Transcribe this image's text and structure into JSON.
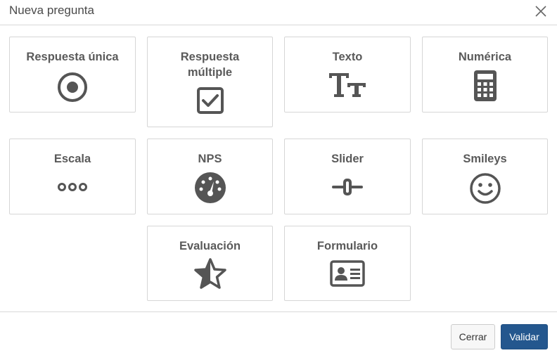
{
  "dialog": {
    "title": "Nueva pregunta"
  },
  "question_types": [
    {
      "label": "Respuesta única",
      "icon": "radio-button-icon"
    },
    {
      "label": "Respuesta múltiple",
      "icon": "checkbox-icon"
    },
    {
      "label": "Texto",
      "icon": "text-type-icon"
    },
    {
      "label": "Numérica",
      "icon": "calculator-icon"
    },
    {
      "label": "Escala",
      "icon": "dots-scale-icon"
    },
    {
      "label": "NPS",
      "icon": "gauge-icon"
    },
    {
      "label": "Slider",
      "icon": "slider-icon"
    },
    {
      "label": "Smileys",
      "icon": "smiley-icon"
    },
    {
      "label": "Evaluación",
      "icon": "half-star-icon"
    },
    {
      "label": "Formulario",
      "icon": "id-card-icon"
    }
  ],
  "footer": {
    "cancel_label": "Cerrar",
    "confirm_label": "Validar"
  },
  "colors": {
    "icon": "#555555",
    "primary_button": "#24578e",
    "border": "#d6d6d6"
  }
}
